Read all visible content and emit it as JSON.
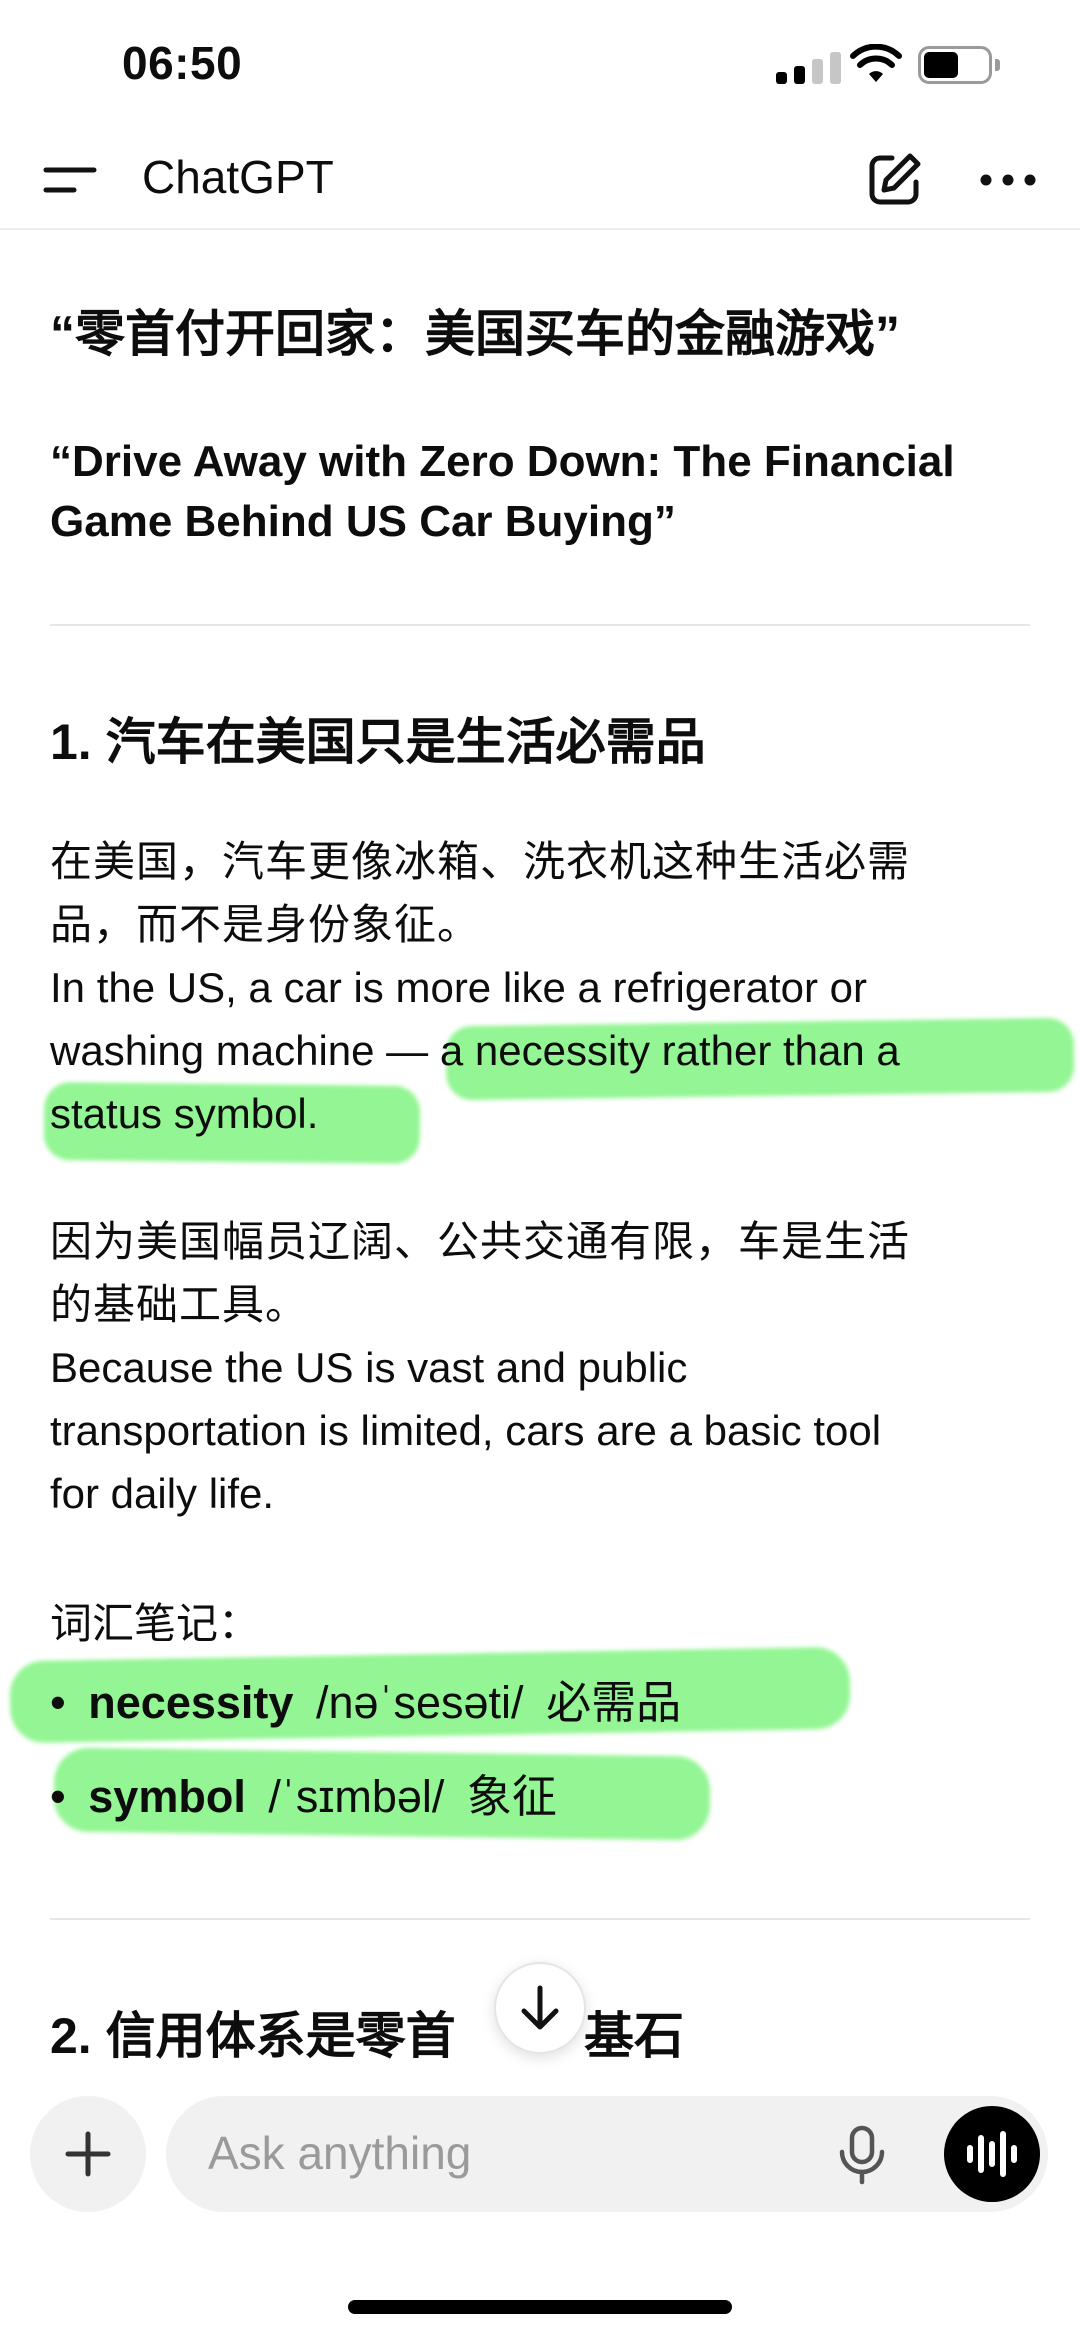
{
  "status_bar": {
    "time": "06:50",
    "battery_fraction": 0.55
  },
  "header": {
    "title": "ChatGPT",
    "menu_icon": "menu-icon",
    "compose_icon": "compose-icon",
    "more_icon": "more-icon"
  },
  "article": {
    "title_zh": "“零首付开回家：美国买车的金融游戏”",
    "title_en": "“Drive Away with Zero Down: The Financial Game Behind US Car Buying”",
    "section1": {
      "heading": "1. 汽车在美国只是生活必需品",
      "p1_zh_line1": "在美国，汽车更像冰箱、洗衣机这种生活必需",
      "p1_zh_line2": "品，而不是身份象征。",
      "p1_en_line1": "In the US, a car is more like a refrigerator or",
      "p1_en_line2": "washing machine — a necessity rather than a",
      "p1_en_line3": "status symbol.",
      "p2_zh_line1": "因为美国幅员辽阔、公共交通有限，车是生活",
      "p2_zh_line2": "的基础工具。",
      "p2_en_line1": "Because the US is vast and public",
      "p2_en_line2": "transportation is limited, cars are a basic tool",
      "p2_en_line3": "for daily life.",
      "vocab_label": "词汇笔记：",
      "vocab": [
        {
          "bullet": "•",
          "word": "necessity",
          "ipa": "/nəˈsesəti/",
          "meaning": "必需品"
        },
        {
          "bullet": "•",
          "word": "symbol",
          "ipa": "/ˈsɪmbəl/",
          "meaning": "象征"
        }
      ]
    },
    "section2": {
      "heading_visible_left": "2. 信用体系是零首",
      "heading_visible_right": "基石"
    }
  },
  "highlight_color": "#8ef58e",
  "composer": {
    "placeholder": "Ask anything",
    "plus_icon": "plus-icon",
    "mic_icon": "mic-icon",
    "voice_icon": "voice-mode-icon"
  },
  "scroll_button_icon": "arrow-down-icon"
}
